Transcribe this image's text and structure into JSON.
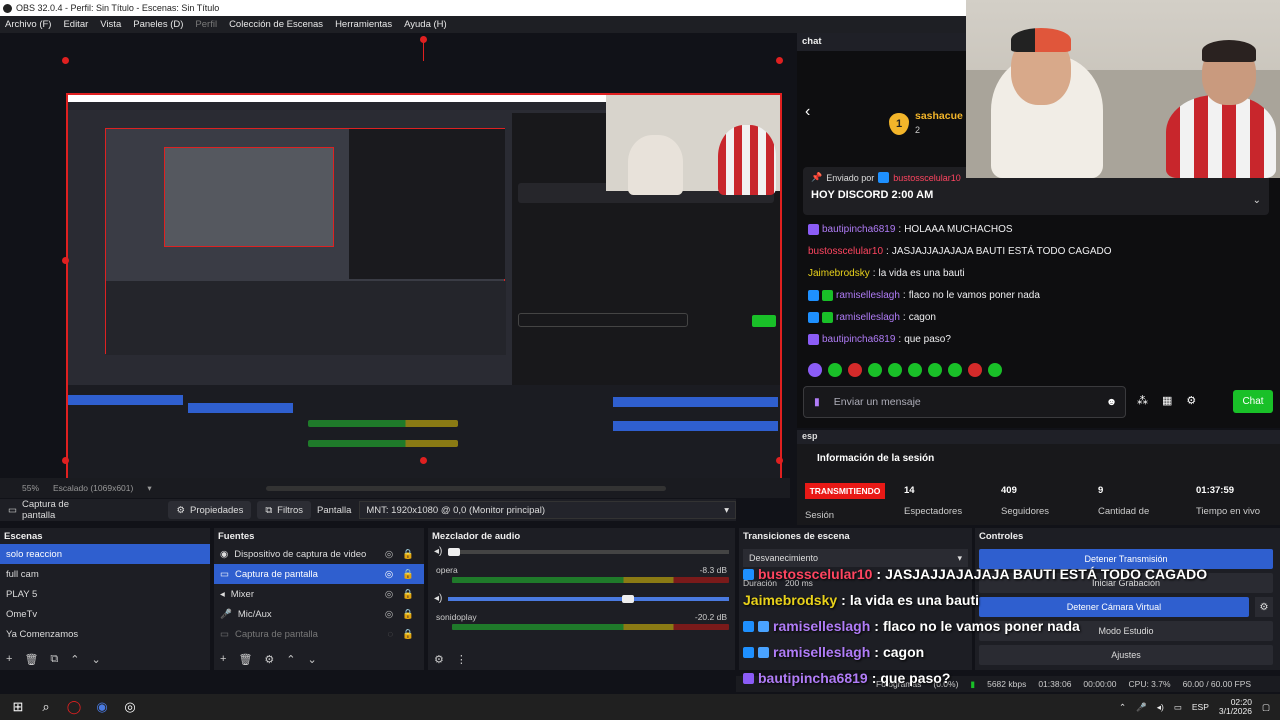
{
  "window": {
    "title": "OBS 32.0.4 - Perfil: Sin Título - Escenas: Sin Título"
  },
  "menu": [
    "Archivo (F)",
    "Editar",
    "Vista",
    "Paneles (D)",
    "Perfil",
    "Colección de Escenas",
    "Herramientas",
    "Ayuda (H)"
  ],
  "status": {
    "zoom": "55%",
    "scale": "Escalado (1069x601)"
  },
  "toolbar": {
    "source_label": "Captura de pantalla",
    "props": "Propiedades",
    "filters": "Filtros",
    "screen": "Pantalla",
    "monitor": "MNT: 1920x1080 @ 0,0 (Monitor principal)"
  },
  "scenes": {
    "title": "Escenas",
    "items": [
      "solo reaccion",
      "full cam",
      "PLAY 5",
      "OmeTv",
      "Ya Comenzamos"
    ]
  },
  "sources": {
    "title": "Fuentes",
    "items": [
      "Dispositivo de captura de video",
      "Captura de pantalla",
      "Mixer",
      "Mic/Aux",
      "Captura de pantalla"
    ]
  },
  "mixer": {
    "title": "Mezclador de audio",
    "channels": [
      {
        "name": "opera",
        "db": "-8.3 dB"
      },
      {
        "name": "sonidoplay",
        "db": "-20.2 dB"
      }
    ]
  },
  "transitions": {
    "title": "Transiciones de escena",
    "selected": "Desvanecimiento",
    "duration_label": "Duración",
    "duration": "200 ms"
  },
  "controls": {
    "title": "Controles",
    "buttons": [
      "Detener Transmisión",
      "Iniciar Grabación",
      "Detener Cámara Virtual",
      "Modo Estudio",
      "Ajustes"
    ]
  },
  "chat": {
    "header": "chat",
    "top_user": "sashacue",
    "top_count": "2",
    "pinned_by": "Enviado por",
    "pinned_user": "bustosscelular10",
    "pinned_text": "HOY DISCORD 2:00 AM",
    "messages": [
      {
        "user": "bautipincha6819",
        "text": "HOLAAA MUCHACHOS",
        "color": "#b07cf7"
      },
      {
        "user": "bustosscelular10",
        "text": "JASJAJJAJAJAJA BAUTI ESTÁ TODO CAGADO",
        "color": "#ff4560"
      },
      {
        "user": "Jaimebrodsky",
        "text": "la vida es una bauti",
        "color": "#e9d21b"
      },
      {
        "user": "ramiselleslagh",
        "text": "flaco no le vamos poner nada",
        "color": "#b07cf7"
      },
      {
        "user": "ramiselleslagh",
        "text": "cagon",
        "color": "#b07cf7"
      },
      {
        "user": "bautipincha6819",
        "text": "que paso?",
        "color": "#b07cf7"
      }
    ],
    "input_placeholder": "Enviar un mensaje",
    "send": "Chat"
  },
  "session": {
    "header": "esp",
    "title": "Información de la sesión",
    "status": "TRANSMITIENDO",
    "status_sub": "Sesión",
    "viewers": "14",
    "viewers_label": "Espectadores",
    "followers": "409",
    "followers_label": "Seguidores",
    "count": "9",
    "count_label": "Cantidad de",
    "uptime": "01:37:59",
    "uptime_label": "Tiempo en vivo"
  },
  "overlay": [
    {
      "user": "bustosscelular10",
      "text": "JASJAJJAJAJAJA BAUTI ESTÁ TODO CAGADO",
      "color": "#ff4560"
    },
    {
      "user": "Jaimebrodsky",
      "text": "la vida es una bauti",
      "color": "#e9d21b"
    },
    {
      "user": "ramiselleslagh",
      "text": "flaco no le vamos poner nada",
      "color": "#b07cf7"
    },
    {
      "user": "ramiselleslagh",
      "text": "cagon",
      "color": "#b07cf7"
    },
    {
      "user": "bautipincha6819",
      "text": "que paso?",
      "color": "#b07cf7"
    }
  ],
  "obs_status": {
    "frames": "Fotogramas",
    "frames_pct": "(0.0%)",
    "kbps": "5682 kbps",
    "live": "01:38:06",
    "rec": "00:00:00",
    "cpu": "CPU: 3.7%",
    "fps": "60.00 / 60.00 FPS"
  },
  "taskbar": {
    "lang": "ESP",
    "time": "02:20",
    "date": "3/1/2026"
  }
}
